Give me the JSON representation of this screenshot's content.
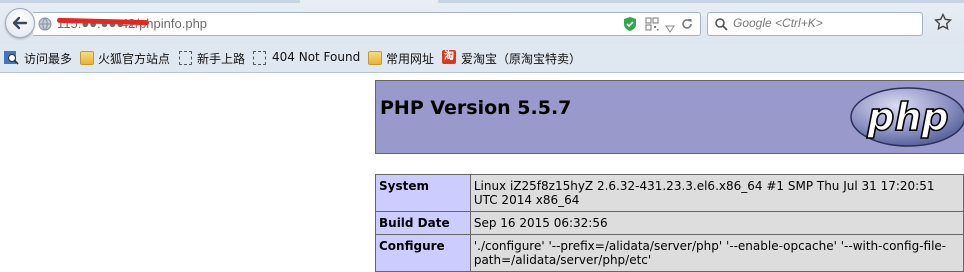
{
  "browser": {
    "url": "115.●●.●●●.241/phpinfo.php",
    "url_visible_suffix": "41/phpinfo.php",
    "search_placeholder": "Google <Ctrl+K>",
    "icons": [
      "back-arrow-icon",
      "globe-icon",
      "shield-icon",
      "qr-code-icon",
      "dropdown-arrow-icon",
      "reload-icon",
      "search-icon",
      "star-icon"
    ]
  },
  "bookmarks": [
    {
      "label": "访问最多",
      "icon": "magnifier-icon"
    },
    {
      "label": "火狐官方站点",
      "icon": "folder-icon"
    },
    {
      "label": "新手上路",
      "icon": "blank-page-icon"
    },
    {
      "label": "404 Not Found",
      "icon": "blank-page-icon"
    },
    {
      "label": "常用网址",
      "icon": "folder-icon"
    },
    {
      "label": "爱淘宝（原淘宝特卖）",
      "icon": "taobao-icon",
      "icon_glyph": "淘"
    }
  ],
  "php": {
    "title": "PHP Version 5.5.7",
    "logo_text": "php",
    "rows": [
      {
        "key": "System",
        "value": "Linux iZ25f8z15hyZ 2.6.32-431.23.3.el6.x86_64 #1 SMP Thu Jul 31 17:20:51 UTC 2014 x86_64"
      },
      {
        "key": "Build Date",
        "value": "Sep 16 2015 06:32:56"
      },
      {
        "key": "Configure",
        "value": "'./configure' '--prefix=/alidata/server/php' '--enable-opcache' '--with-config-file-path=/alidata/server/php/etc'"
      }
    ]
  },
  "colors": {
    "php_header": "#9999cc",
    "key_cell": "#ccccff",
    "value_cell": "#dddddd",
    "redaction": "#e8261f"
  }
}
